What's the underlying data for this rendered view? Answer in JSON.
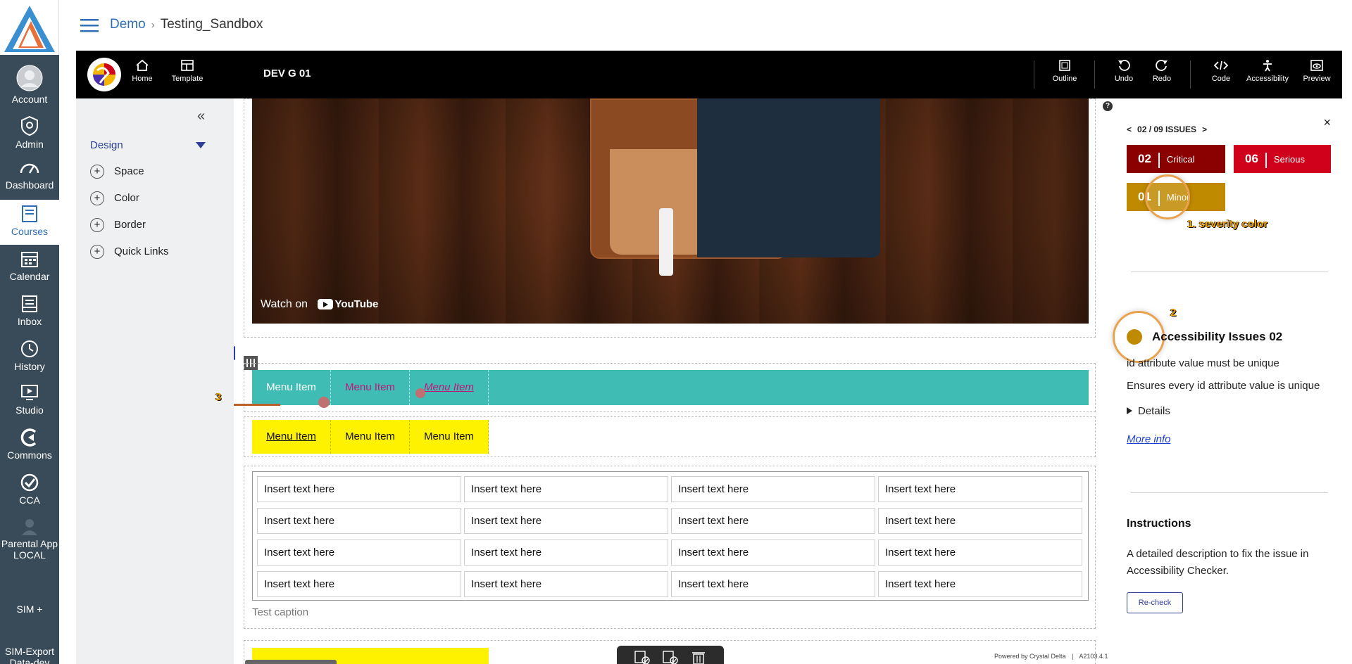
{
  "breadcrumb": {
    "root": "Demo",
    "current": "Testing_Sandbox"
  },
  "global_nav": [
    {
      "label": "Account",
      "icon": "account-icon"
    },
    {
      "label": "Admin",
      "icon": "shield-icon"
    },
    {
      "label": "Dashboard",
      "icon": "dashboard-icon"
    },
    {
      "label": "Courses",
      "icon": "book-icon",
      "active": true
    },
    {
      "label": "Calendar",
      "icon": "calendar-icon"
    },
    {
      "label": "Inbox",
      "icon": "inbox-icon"
    },
    {
      "label": "History",
      "icon": "clock-icon"
    },
    {
      "label": "Studio",
      "icon": "studio-icon"
    },
    {
      "label": "Commons",
      "icon": "commons-icon"
    },
    {
      "label": "CCA",
      "icon": "check-circle-icon"
    },
    {
      "label": "Parental App LOCAL",
      "icon": "user-icon"
    },
    {
      "label": "SIM +",
      "icon": ""
    },
    {
      "label": "SIM-Export Data-dev",
      "icon": ""
    }
  ],
  "toolbar": {
    "home": "Home",
    "template": "Template",
    "title": "DEV G 01",
    "outline": "Outline",
    "undo": "Undo",
    "redo": "Redo",
    "code": "Code",
    "accessibility": "Accessibility",
    "preview": "Preview"
  },
  "design_panel": {
    "heading": "Design",
    "items": [
      "Space",
      "Color",
      "Border",
      "Quick Links"
    ]
  },
  "canvas": {
    "video_watch_label": "Watch on",
    "video_brand": "YouTube",
    "menu_item_label": "Menu Item",
    "cell_text": "Insert text here",
    "caption": "Test caption",
    "powered_by": "Powered by Crystal Delta",
    "version": "A2103.4.1",
    "help": "?"
  },
  "annotations": {
    "a1": "1. severity color",
    "a2": "2",
    "a3": "3"
  },
  "accessibility_panel": {
    "issue_nav": "02 / 09 ISSUES",
    "severities": [
      {
        "count": "02",
        "label": "Critical",
        "color": "#8b0000"
      },
      {
        "count": "06",
        "label": "Serious",
        "color": "#d0021b"
      },
      {
        "count": "01",
        "label": "Minor",
        "color": "#c08a00"
      }
    ],
    "issue_title": "Accessibility Issues 02",
    "issue_rule": "id attribute value must be unique",
    "issue_desc": "Ensures every id attribute value is unique",
    "details": "Details",
    "more_info": "More info",
    "instructions_title": "Instructions",
    "instructions_text": "A detailed description to fix the issue in Accessibility Checker.",
    "recheck": "Re-check"
  },
  "colors": {
    "menu_teal": "#3fbcb3",
    "menu_yellow": "#fff200",
    "minor": "#c08a00",
    "annotation_orange": "#f5a300"
  }
}
